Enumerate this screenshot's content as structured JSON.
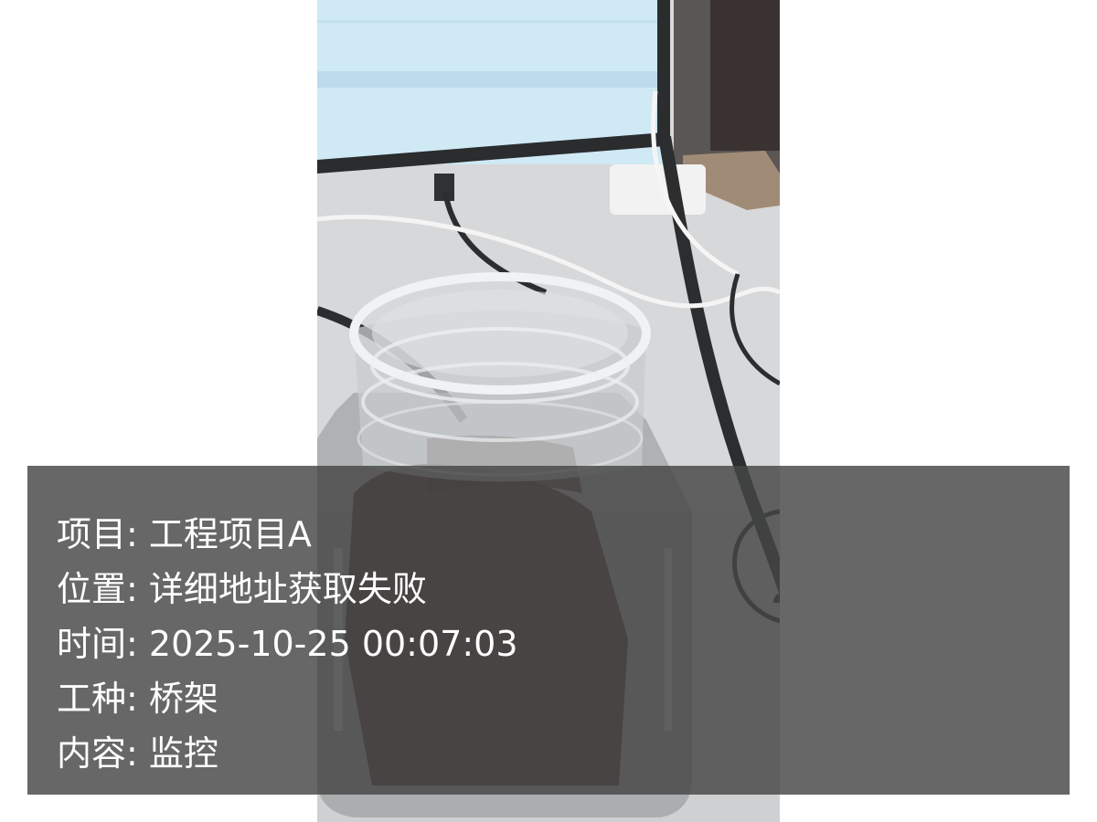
{
  "watermark": {
    "lines": [
      {
        "label": "项目",
        "value": "工程项目A"
      },
      {
        "label": "位置",
        "value": "详细地址获取失败"
      },
      {
        "label": "时间",
        "value": "2025-10-25 00:07:03"
      },
      {
        "label": "工种",
        "value": "桥架"
      },
      {
        "label": "内容",
        "value": "监控"
      }
    ],
    "separator": ": "
  },
  "colors": {
    "overlay": "#464646",
    "text": "#ffffff",
    "monitor_screen": "#cfe9f5",
    "desk": "#d9dadb"
  }
}
